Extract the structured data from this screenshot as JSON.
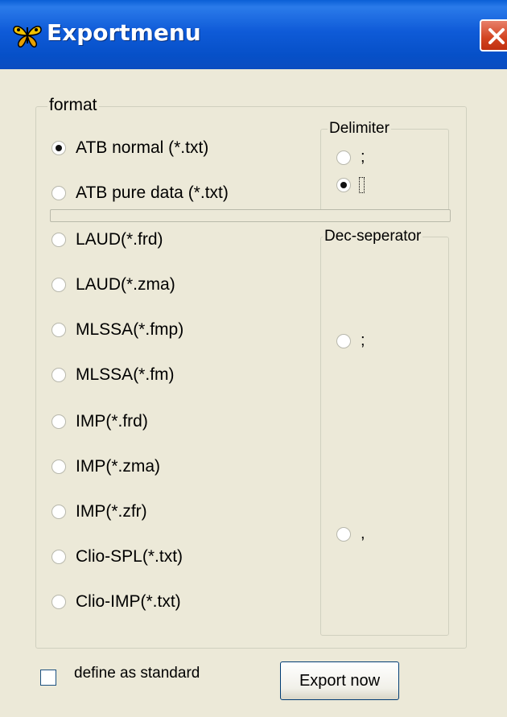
{
  "window": {
    "title": "Exportmenu",
    "icon": "butterfly-app-icon",
    "close_icon": "close-icon"
  },
  "format_group": {
    "label": "format",
    "options": [
      {
        "label": "ATB normal (*.txt)",
        "checked": true
      },
      {
        "label": "ATB pure data (*.txt)",
        "checked": false
      },
      {
        "label": "LAUD(*.frd)",
        "checked": false
      },
      {
        "label": "LAUD(*.zma)",
        "checked": false
      },
      {
        "label": "MLSSA(*.fmp)",
        "checked": false
      },
      {
        "label": "MLSSA(*.fm)",
        "checked": false
      },
      {
        "label": "IMP(*.frd)",
        "checked": false
      },
      {
        "label": "IMP(*.zma)",
        "checked": false
      },
      {
        "label": "IMP(*.zfr)",
        "checked": false
      },
      {
        "label": "Clio-SPL(*.txt)",
        "checked": false
      },
      {
        "label": "Clio-IMP(*.txt)",
        "checked": false
      }
    ]
  },
  "delimiter_group": {
    "label": "Delimiter",
    "options": [
      {
        "label": ";",
        "checked": false
      },
      {
        "label": "",
        "checked": true
      }
    ]
  },
  "dec_separator_group": {
    "label": "Dec-seperator",
    "options": [
      {
        "label": ";",
        "checked": false
      },
      {
        "label": ",",
        "checked": false
      }
    ]
  },
  "define_standard": {
    "label": "define as standard",
    "checked": false
  },
  "export_button": {
    "label": "Export now"
  },
  "colors": {
    "titlebar": "#0A5FD6",
    "close_button": "#D2431F",
    "dialog_bg": "#ECE9D8"
  }
}
